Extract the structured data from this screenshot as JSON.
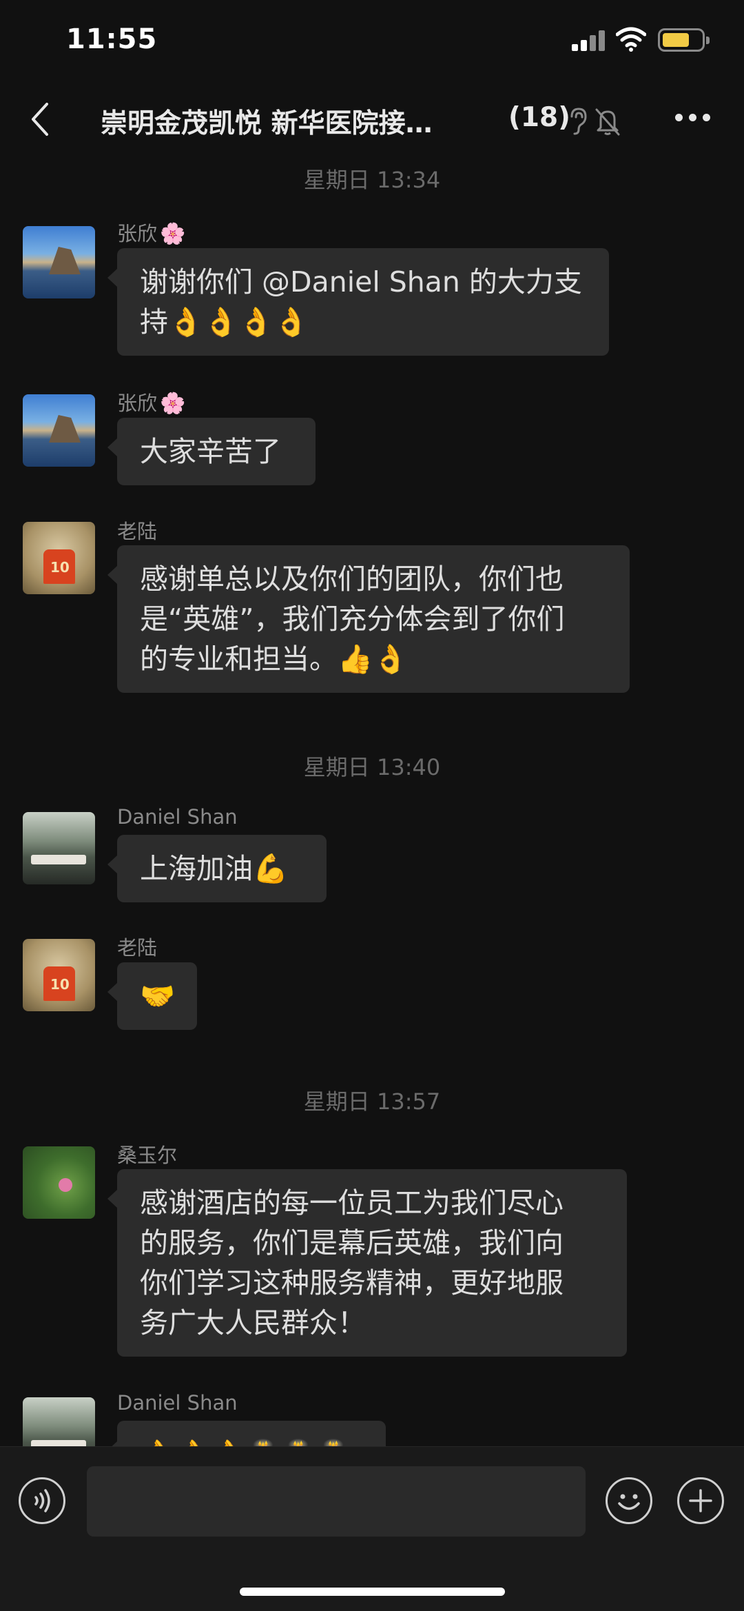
{
  "status_bar": {
    "time": "11:55"
  },
  "header": {
    "title": "崇明金茂凯悦 新华医院接…",
    "member_count": "(18)"
  },
  "messages": [
    {
      "type": "timestamp",
      "text": "星期日 13:34"
    },
    {
      "type": "message",
      "sender": "张欣",
      "sender_badge": "🌸",
      "avatar": "mountain-lake-photo",
      "lines": [
        "谢谢你们 @Daniel Shan 的大力支",
        "持👌👌👌👌"
      ]
    },
    {
      "type": "message",
      "sender": "张欣",
      "sender_badge": "🌸",
      "avatar": "mountain-lake-photo",
      "lines": [
        "大家辛苦了"
      ]
    },
    {
      "type": "message",
      "sender": "老陆",
      "avatar": "person-orange-jersey-photo",
      "lines": [
        "感谢单总以及你们的团队，你们也",
        "是“英雄”，我们充分体会到了你们",
        "的专业和担当。👍👌"
      ]
    },
    {
      "type": "timestamp",
      "text": "星期日 13:40"
    },
    {
      "type": "message",
      "sender": "Daniel Shan",
      "avatar": "lakeside-room-photo",
      "lines": [
        "上海加油💪"
      ]
    },
    {
      "type": "message",
      "sender": "老陆",
      "avatar": "person-orange-jersey-photo",
      "lines": [
        "🤝"
      ]
    },
    {
      "type": "timestamp",
      "text": "星期日 13:57"
    },
    {
      "type": "message",
      "sender": "桑玉尔",
      "avatar": "lotus-flower-photo",
      "lines": [
        "感谢酒店的每一位员工为我们尽心",
        "的服务，你们是幕后英雄，我们向",
        "你们学习这种服务精神，更好地服",
        "务广大人民群众！"
      ]
    },
    {
      "type": "message",
      "sender": "Daniel Shan",
      "avatar": "lakeside-room-photo",
      "lines": [
        "👌👌👌🎂🎂🎂"
      ]
    }
  ],
  "colors": {
    "background": "#111111",
    "bubble": "#2c2c2c",
    "battery": "#f2cb45"
  }
}
